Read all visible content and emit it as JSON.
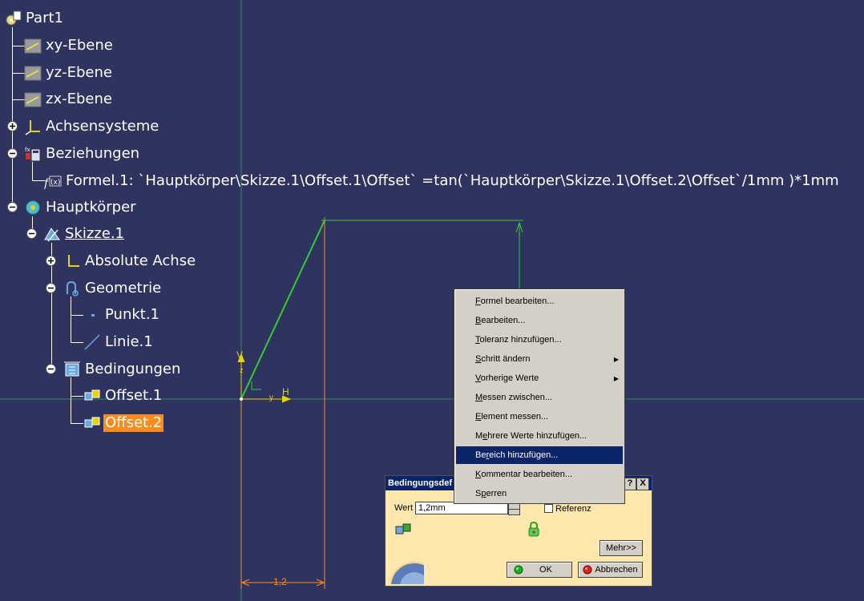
{
  "tree": {
    "root": "Part1",
    "xy_plane": "xy-Ebene",
    "yz_plane": "yz-Ebene",
    "zx_plane": "zx-Ebene",
    "axis_systems": "Achsensysteme",
    "relations": "Beziehungen",
    "formula": "Formel.1: `Hauptkörper\\Skizze.1\\Offset.1\\Offset` =tan(`Hauptkörper\\Skizze.1\\Offset.2\\Offset`/1mm )*1mm",
    "main_body": "Hauptkörper",
    "sketch": "Skizze.1",
    "absolute_axis": "Absolute Achse",
    "geometry": "Geometrie",
    "point": "Punkt.1",
    "line": "Linie.1",
    "constraints": "Bedingungen",
    "offset1": "Offset.1",
    "offset2": "Offset.2"
  },
  "sketch": {
    "v_label": "V",
    "z_label": "z",
    "h_label": "H",
    "y_label": "y",
    "dimension": "1,2"
  },
  "context_menu": {
    "items": [
      {
        "u": "F",
        "rest": "ormel bearbeiten..."
      },
      {
        "u": "B",
        "rest": "earbeiten..."
      },
      {
        "u": "T",
        "rest": "oleranz hinzufügen..."
      },
      {
        "u": "S",
        "rest": "chritt ändern"
      },
      {
        "u": "V",
        "rest": "orherige Werte"
      },
      {
        "u": "M",
        "rest": "essen zwischen..."
      },
      {
        "u": "E",
        "rest": "lement messen..."
      },
      {
        "pre": "M",
        "u": "e",
        "rest": "hrere Werte hinzufügen..."
      },
      {
        "pre": "Be",
        "u": "r",
        "rest": "eich hinzufügen..."
      },
      {
        "u": "K",
        "rest": "ommentar bearbeiten..."
      },
      {
        "pre": "S",
        "u": "p",
        "rest": "erren"
      }
    ]
  },
  "dialog": {
    "title": "Bedingungsdef",
    "help_btn": "?",
    "close_btn": "X",
    "wert_label": "Wert",
    "wert_value": "1,2mm",
    "referenz_label": "Referenz",
    "mehr_btn": "Mehr>>",
    "ok_btn": "OK",
    "cancel_btn": "Abbrechen"
  },
  "colors": {
    "background": "#2e3360",
    "selection": "#ff8c1a",
    "sketch_line": "#33cc33",
    "dimension": "#ff8c1a",
    "menu_highlight": "#0a246a"
  }
}
